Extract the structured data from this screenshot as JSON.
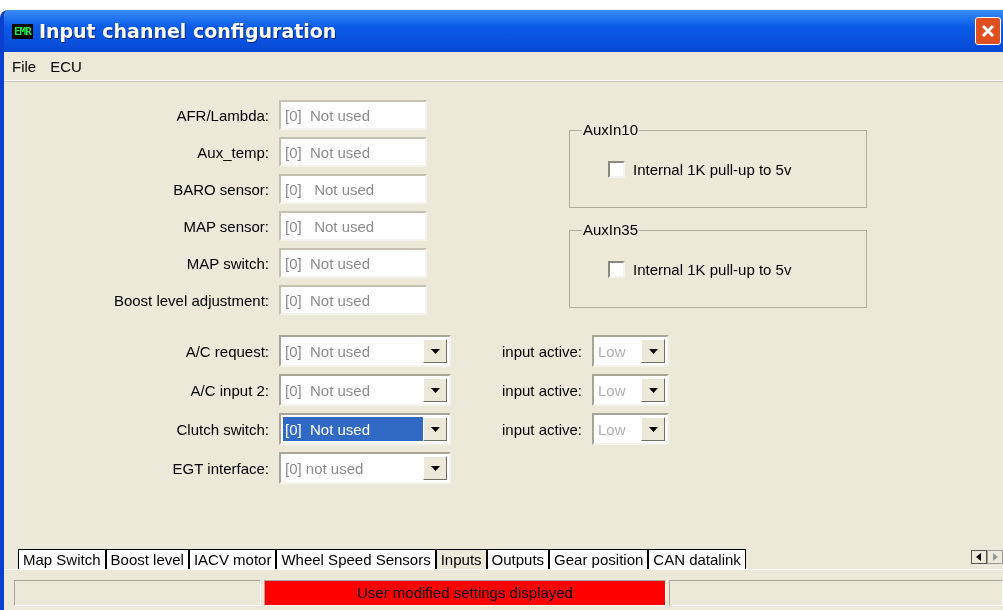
{
  "window": {
    "title": "Input channel configuration",
    "logo": "EMR"
  },
  "menu": [
    "File",
    "ECU"
  ],
  "text_fields": [
    {
      "label": "AFR/Lambda:",
      "value": "[0]  Not used",
      "disabled": true
    },
    {
      "label": "Aux_temp:",
      "value": "[0]  Not used",
      "disabled": true
    },
    {
      "label": "BARO sensor:",
      "value": "[0]   Not used",
      "disabled": true
    },
    {
      "label": "MAP sensor:",
      "value": "[0]   Not used",
      "disabled": true
    },
    {
      "label": "MAP switch:",
      "value": "[0]  Not used",
      "disabled": true
    },
    {
      "label": "Boost level adjustment:",
      "value": "[0]  Not used",
      "disabled": true
    }
  ],
  "combos": [
    {
      "label": "A/C request:",
      "value": "[0]  Not used",
      "selected": false,
      "active": {
        "label": "input active:",
        "value": "Low",
        "disabled": true
      }
    },
    {
      "label": "A/C input 2:",
      "value": "[0]  Not used",
      "selected": false,
      "active": {
        "label": "input active:",
        "value": "Low",
        "disabled": true
      }
    },
    {
      "label": "Clutch switch:",
      "value": "[0]  Not used",
      "selected": true,
      "active": {
        "label": "input active:",
        "value": "Low",
        "disabled": true
      }
    },
    {
      "label": "EGT interface:",
      "value": "[0] not used",
      "selected": false
    }
  ],
  "groups": [
    {
      "title": "AuxIn10",
      "checkbox": {
        "label": "Internal 1K pull-up to 5v",
        "checked": false
      }
    },
    {
      "title": "AuxIn35",
      "checkbox": {
        "label": "Internal 1K pull-up to 5v",
        "checked": false
      }
    }
  ],
  "tabs": [
    {
      "label": "Map Switch",
      "selected": false
    },
    {
      "label": "Boost level",
      "selected": false
    },
    {
      "label": "IACV motor",
      "selected": false
    },
    {
      "label": "Wheel Speed Sensors",
      "selected": false
    },
    {
      "label": "Inputs",
      "selected": true
    },
    {
      "label": "Outputs",
      "selected": false
    },
    {
      "label": "Gear position",
      "selected": false
    },
    {
      "label": "CAN datalink",
      "selected": false
    }
  ],
  "status_bar": [
    {
      "kind": "empty"
    },
    {
      "kind": "alert",
      "text": "User modified settings displayed"
    },
    {
      "kind": "empty"
    }
  ]
}
